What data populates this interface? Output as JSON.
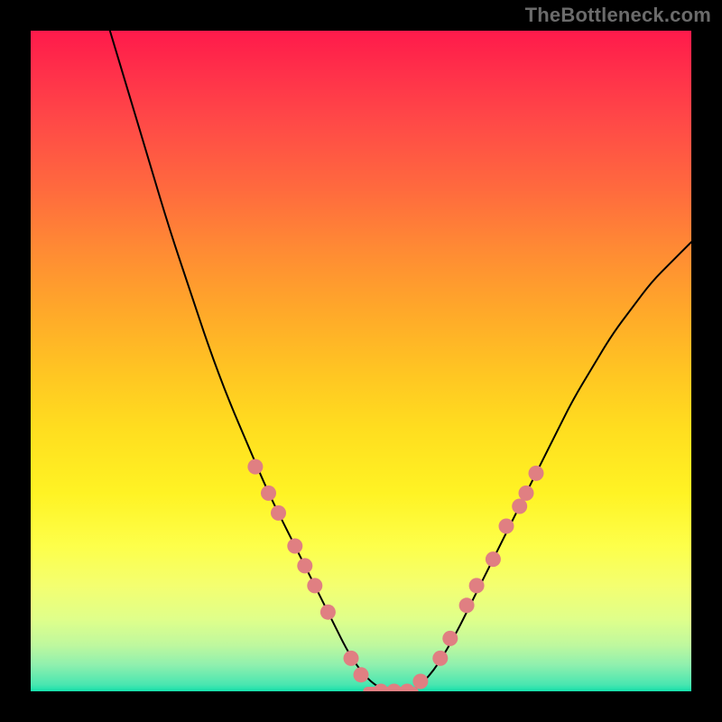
{
  "watermark": "TheBottleneck.com",
  "colors": {
    "dot": "#e07f82",
    "curve": "#000000",
    "frame": "#000000",
    "gradient_top": "#ff1a4b",
    "gradient_bottom": "#14e0ab"
  },
  "chart_data": {
    "type": "line",
    "title": "",
    "xlabel": "",
    "ylabel": "",
    "xlim": [
      0,
      100
    ],
    "ylim": [
      0,
      100
    ],
    "series": [
      {
        "name": "bottleneck-curve",
        "x": [
          12,
          15,
          18,
          21,
          24,
          27,
          30,
          33,
          36,
          39,
          42,
          44,
          46,
          48,
          50,
          52,
          54,
          56,
          58,
          61,
          64,
          67,
          70,
          73,
          76,
          79,
          82,
          85,
          88,
          91,
          94,
          97,
          100
        ],
        "y": [
          100,
          90,
          80,
          70,
          61,
          52,
          44,
          37,
          30,
          24,
          18,
          14,
          10,
          6,
          3,
          1,
          0,
          0,
          0,
          3,
          8,
          14,
          20,
          26,
          32,
          38,
          44,
          49,
          54,
          58,
          62,
          65,
          68
        ]
      }
    ],
    "data_points": [
      {
        "x": 34,
        "y": 34
      },
      {
        "x": 36,
        "y": 30
      },
      {
        "x": 37.5,
        "y": 27
      },
      {
        "x": 40,
        "y": 22
      },
      {
        "x": 41.5,
        "y": 19
      },
      {
        "x": 43,
        "y": 16
      },
      {
        "x": 45,
        "y": 12
      },
      {
        "x": 48.5,
        "y": 5
      },
      {
        "x": 50,
        "y": 2.5
      },
      {
        "x": 53,
        "y": 0
      },
      {
        "x": 55,
        "y": 0
      },
      {
        "x": 57,
        "y": 0
      },
      {
        "x": 59,
        "y": 1.5
      },
      {
        "x": 62,
        "y": 5
      },
      {
        "x": 63.5,
        "y": 8
      },
      {
        "x": 66,
        "y": 13
      },
      {
        "x": 67.5,
        "y": 16
      },
      {
        "x": 70,
        "y": 20
      },
      {
        "x": 72,
        "y": 25
      },
      {
        "x": 74,
        "y": 28
      },
      {
        "x": 75,
        "y": 30
      },
      {
        "x": 76.5,
        "y": 33
      }
    ],
    "plateau": {
      "x_start": 51,
      "x_end": 58,
      "y": 0
    }
  }
}
